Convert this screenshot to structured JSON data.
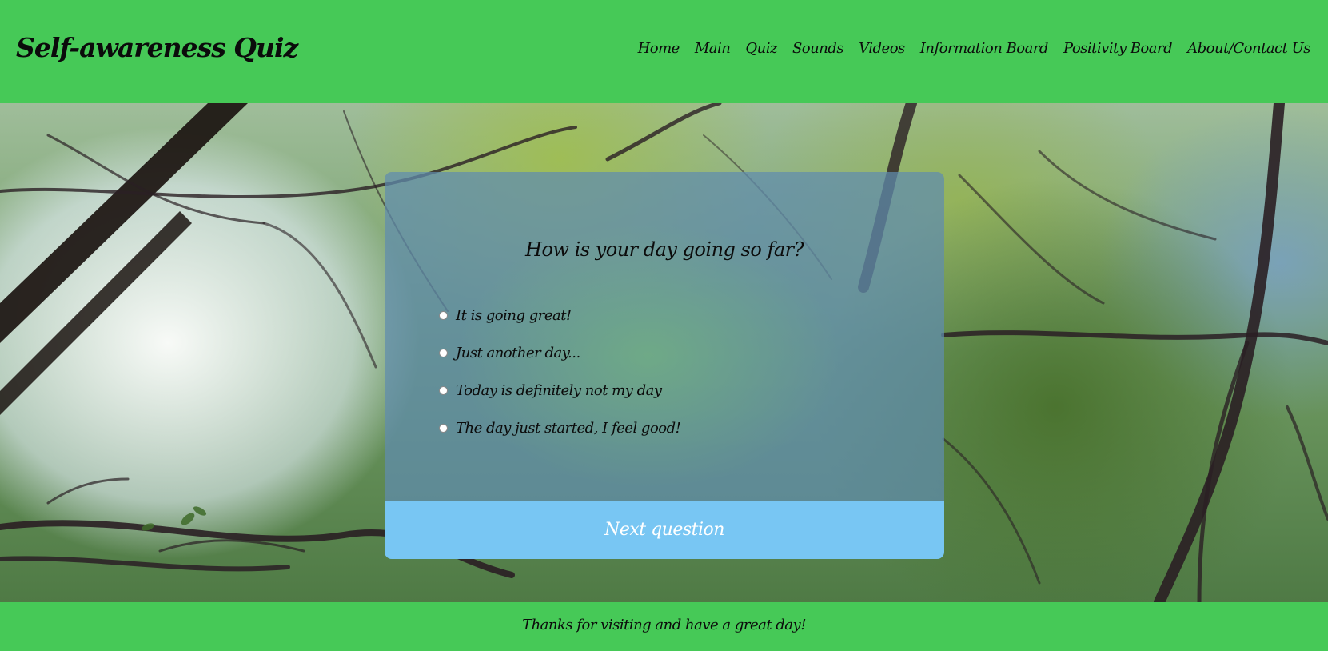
{
  "header": {
    "title": "Self-awareness Quiz",
    "nav": [
      "Home",
      "Main",
      "Quiz",
      "Sounds",
      "Videos",
      "Information Board",
      "Positivity Board",
      "About/Contact Us"
    ]
  },
  "quiz": {
    "question": "How is your day going so far?",
    "options": [
      "It is going great!",
      "Just another day...",
      "Today is definitely not my day",
      "The day just started, I feel good!"
    ],
    "next_label": "Next question"
  },
  "footer": {
    "text": "Thanks for visiting and have a great day!"
  },
  "colors": {
    "header_bg": "#46c957",
    "button_bg": "#78c6f3",
    "card_bg": "#5f8caf"
  }
}
